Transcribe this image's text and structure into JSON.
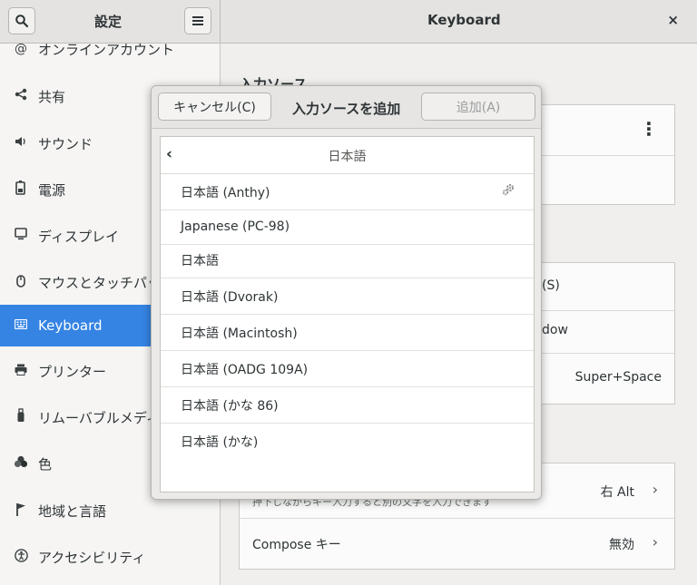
{
  "header": {
    "settings_title": "設定",
    "page_title": "Keyboard",
    "close_glyph": "×",
    "search_icon": "search-icon",
    "menu_icon": "hamburger-menu-icon"
  },
  "sidebar": {
    "items": [
      {
        "label": "オンラインアカウント",
        "icon": "@"
      },
      {
        "label": "共有",
        "icon": "⋖"
      },
      {
        "label": "サウンド",
        "icon": "🔈"
      },
      {
        "label": "電源",
        "icon": "⚡"
      },
      {
        "label": "ディスプレイ",
        "icon": "▭"
      },
      {
        "label": "マウスとタッチパッド",
        "icon": "🖱"
      },
      {
        "label": "Keyboard",
        "icon": "⌨"
      },
      {
        "label": "プリンター",
        "icon": "🖶"
      },
      {
        "label": "リムーバブルメディア",
        "icon": "▮"
      },
      {
        "label": "色",
        "icon": "❀"
      },
      {
        "label": "地域と言語",
        "icon": "⚑"
      },
      {
        "label": "アクセシビリティ",
        "icon": "♿"
      }
    ],
    "active_index": 6
  },
  "main": {
    "section_title": "入力ソース",
    "rows": {
      "shortcut_suffix": "(S)",
      "window_suffix": "dow",
      "switch_value": "Super+Space",
      "alt_hint": "押下しながらキー入力すると別の文字を入力できます",
      "alt_value": "右 Alt",
      "compose_label": "Compose キー",
      "compose_value": "無効",
      "chevron": "›",
      "more_glyph": "⋮"
    }
  },
  "dialog": {
    "cancel_label": "キャンセル(C)",
    "title": "入力ソースを追加",
    "add_label": "追加(A)",
    "list_header": "日本語",
    "back_glyph": "‹",
    "items": [
      {
        "label": "日本語 (Anthy)",
        "has_settings": true
      },
      {
        "label": "Japanese (PC-98)",
        "has_settings": false
      },
      {
        "label": "日本語",
        "has_settings": false
      },
      {
        "label": "日本語 (Dvorak)",
        "has_settings": false
      },
      {
        "label": "日本語 (Macintosh)",
        "has_settings": false
      },
      {
        "label": "日本語 (OADG 109A)",
        "has_settings": false
      },
      {
        "label": "日本語 (かな 86)",
        "has_settings": false
      },
      {
        "label": "日本語 (かな)",
        "has_settings": false
      }
    ]
  },
  "colors": {
    "accent": "#3584e4",
    "sidebar_bg": "#f6f5f4",
    "header_bg": "#e4e3e1"
  }
}
